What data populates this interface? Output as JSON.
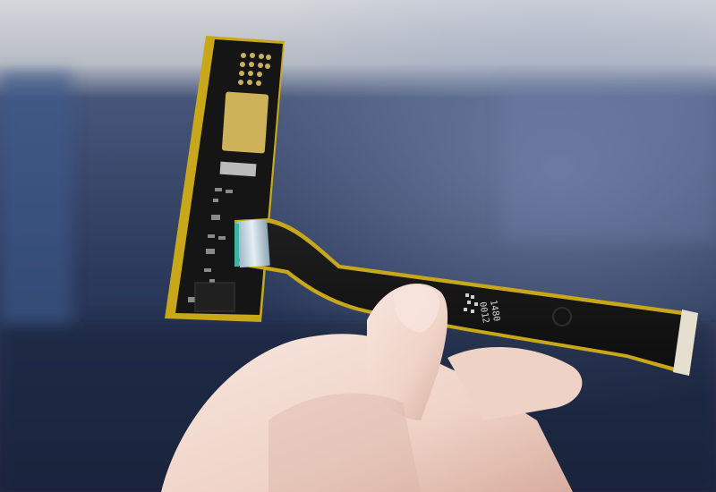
{
  "photo": {
    "subject": "",
    "colors": {
      "background_top": "#c9ccd3",
      "background_mid": "#3a4a6e",
      "background_dark": "#1d2640",
      "pcb_black": "#141414",
      "pcb_edge_yellow": "#c8a81a",
      "gold_pad": "#cdb25a",
      "skin": "#f2dcd2",
      "skin_shadow": "#d9b3a6"
    },
    "silkscreen": {
      "chip_marking": "",
      "flex_code_1": "1480",
      "flex_code_2": "0012",
      "flex_side_text": ""
    }
  }
}
